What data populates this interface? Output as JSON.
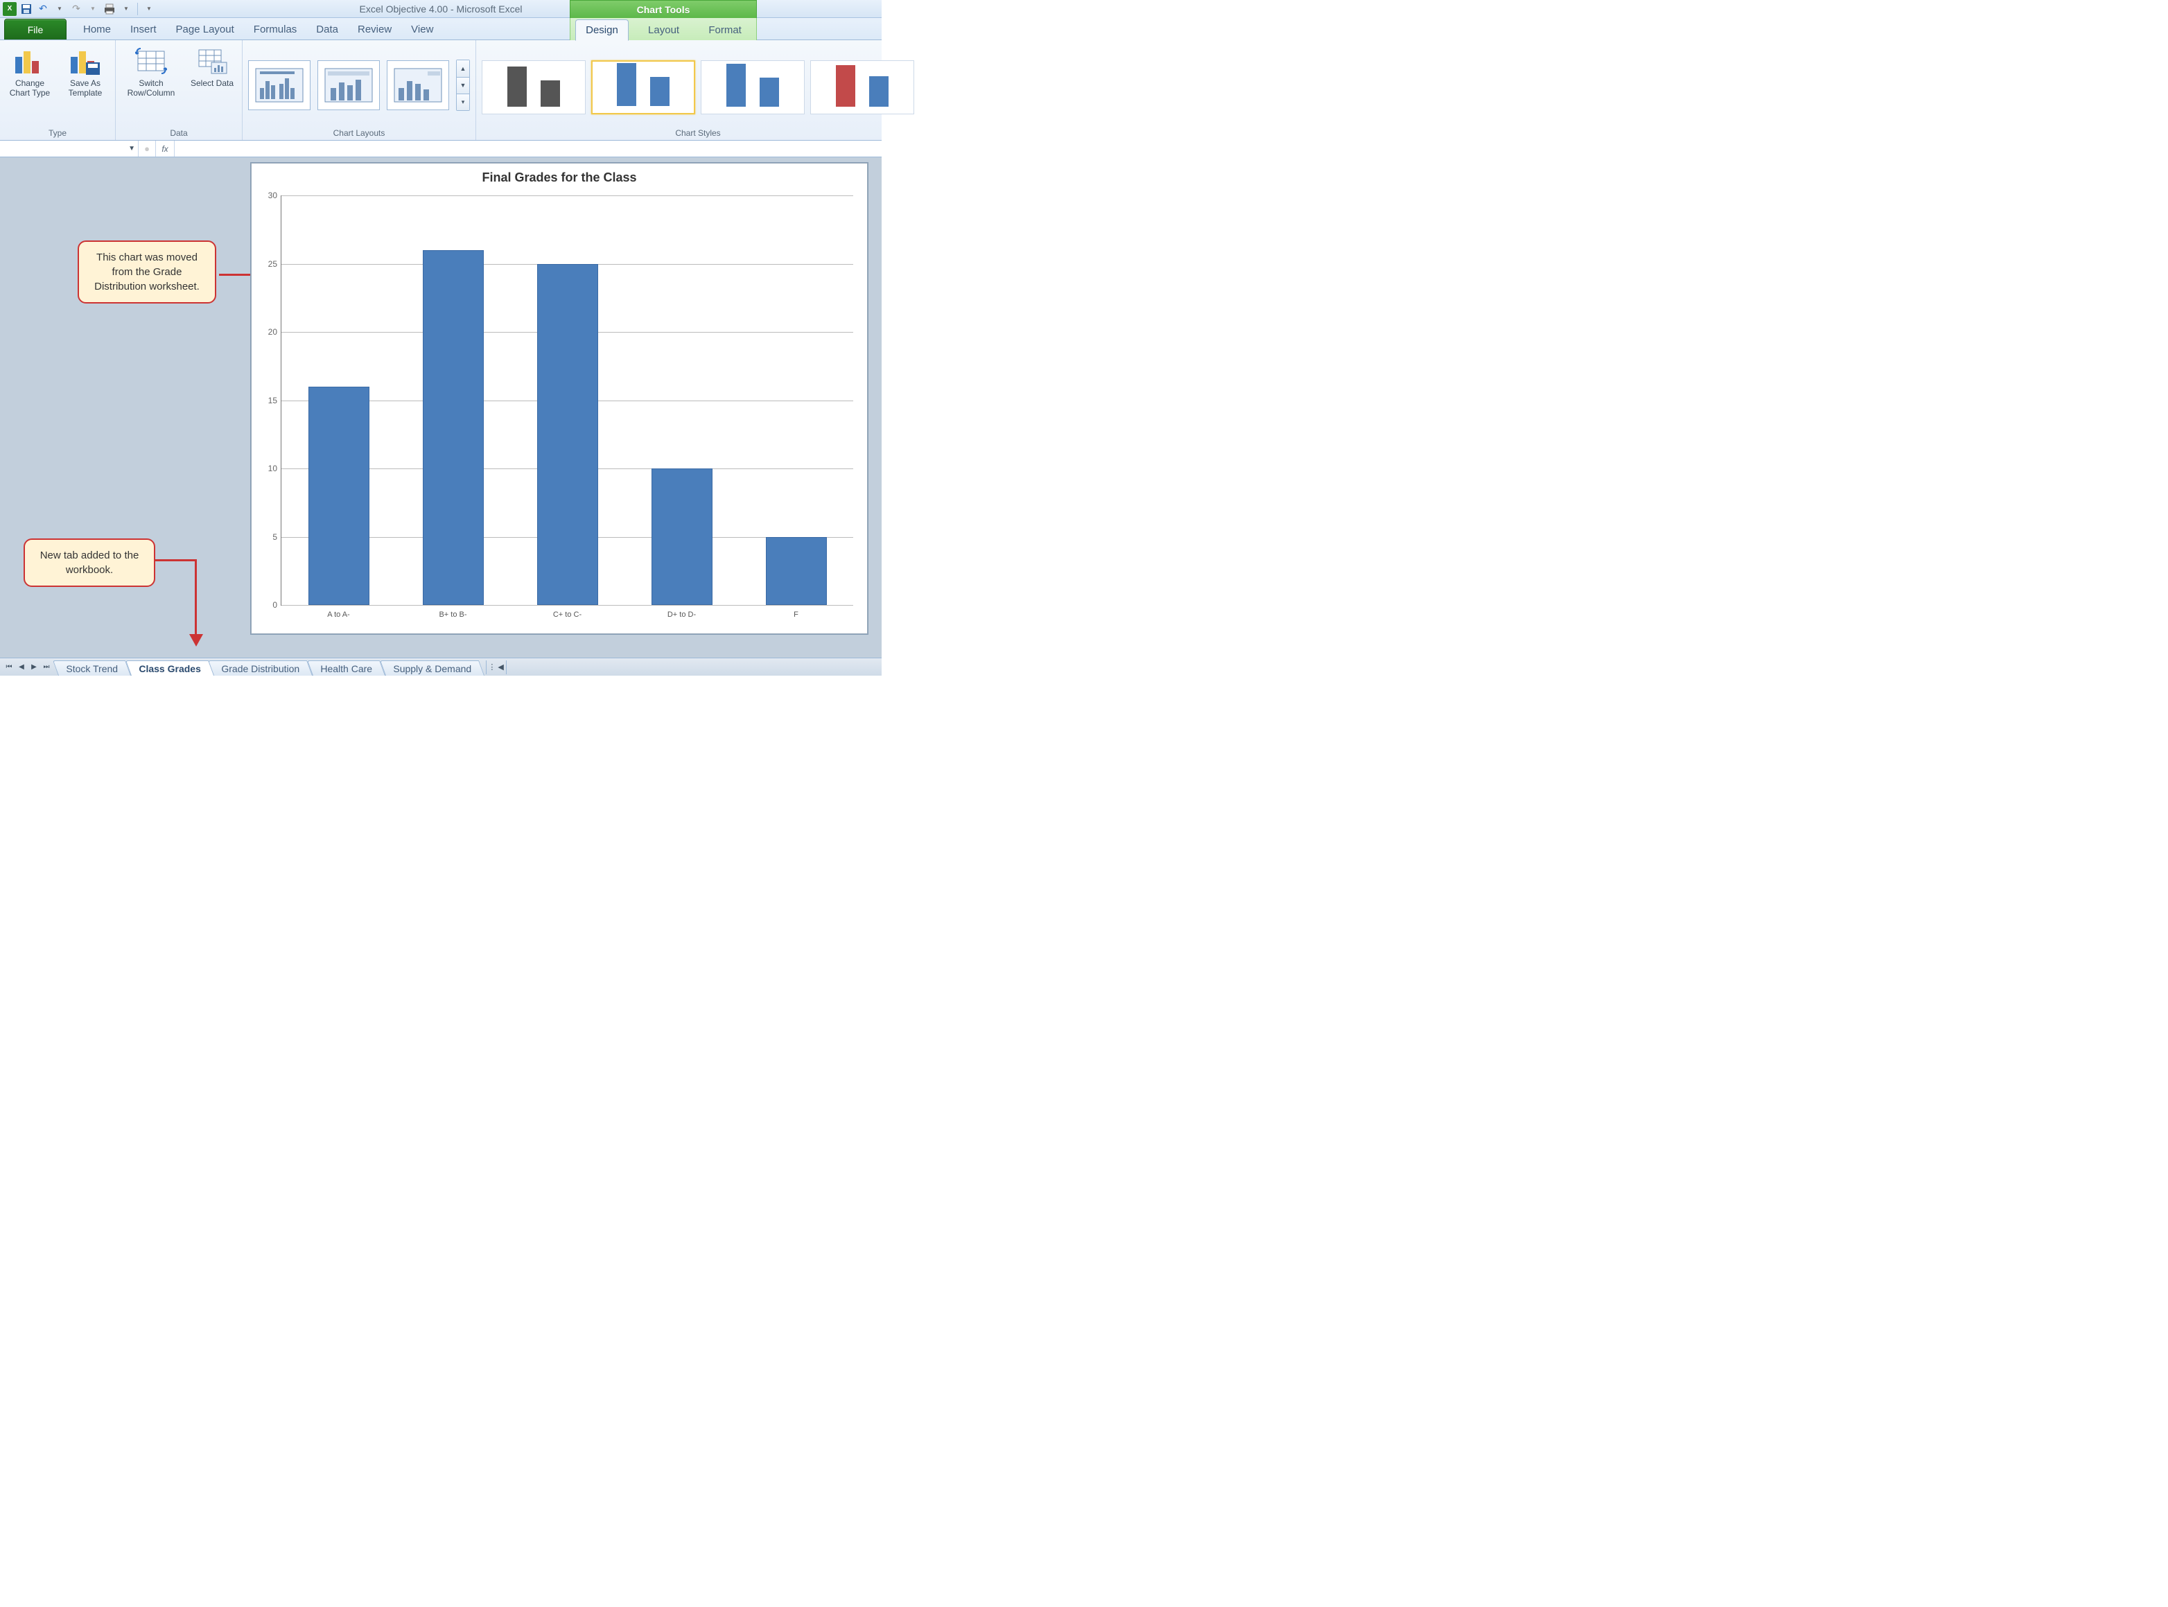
{
  "title": "Excel Objective 4.00 - Microsoft Excel",
  "contextual_tab_title": "Chart Tools",
  "file_tab": "File",
  "tabs": [
    "Home",
    "Insert",
    "Page Layout",
    "Formulas",
    "Data",
    "Review",
    "View"
  ],
  "context_tabs": [
    "Design",
    "Layout",
    "Format"
  ],
  "active_context_tab": "Design",
  "ribbon": {
    "type_group": {
      "label": "Type",
      "change_type": "Change Chart Type",
      "save_as": "Save As Template"
    },
    "data_group": {
      "label": "Data",
      "switch": "Switch Row/Column",
      "select": "Select Data"
    },
    "layouts_group": {
      "label": "Chart Layouts"
    },
    "styles_group": {
      "label": "Chart Styles"
    }
  },
  "formula_bar": {
    "name_box": "",
    "fx_label": "fx",
    "value": ""
  },
  "callouts": {
    "chart_moved": "This chart was moved from the Grade Distribution worksheet.",
    "new_tab": "New tab added to the workbook."
  },
  "sheet_tabs": [
    "Stock Trend",
    "Class Grades",
    "Grade Distribution",
    "Health Care",
    "Supply & Demand"
  ],
  "active_sheet": "Class Grades",
  "chart_data": {
    "type": "bar",
    "title": "Final Grades for the Class",
    "categories": [
      "A to A-",
      "B+ to B-",
      "C+ to C-",
      "D+ to D-",
      "F"
    ],
    "values": [
      16,
      26,
      25,
      10,
      5
    ],
    "ylim": [
      0,
      30
    ],
    "yticks": [
      0,
      5,
      10,
      15,
      20,
      25,
      30
    ],
    "xlabel": "",
    "ylabel": ""
  },
  "style_thumbs": [
    {
      "colors": [
        "#555",
        "#555"
      ],
      "heights": [
        58,
        38
      ]
    },
    {
      "colors": [
        "#4a7ebb",
        "#4a7ebb"
      ],
      "heights": [
        62,
        42
      ],
      "selected": true
    },
    {
      "colors": [
        "#4a7ebb",
        "#4a7ebb"
      ],
      "heights": [
        62,
        42
      ]
    },
    {
      "colors": [
        "#c24a4a",
        "#4a7ebb"
      ],
      "heights": [
        60,
        44
      ]
    }
  ]
}
